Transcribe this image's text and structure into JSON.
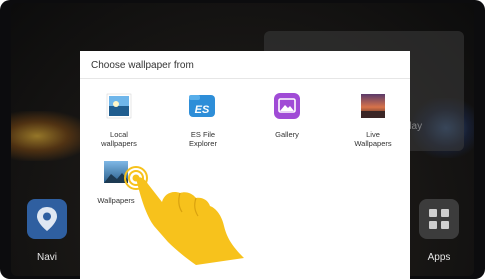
{
  "dialog": {
    "title": "Choose wallpaper from",
    "options": [
      {
        "label": "Local\nwallpapers",
        "icon": "local-wallpapers-icon"
      },
      {
        "label": "ES File\nExplorer",
        "icon": "es-file-explorer-icon"
      },
      {
        "label": "Gallery",
        "icon": "gallery-icon"
      },
      {
        "label": "Live\nWallpapers",
        "icon": "live-wallpapers-icon"
      },
      {
        "label": "Wallpapers",
        "icon": "wallpapers-icon"
      }
    ]
  },
  "dock": {
    "navi_label": "Navi",
    "apps_label": "Apps"
  },
  "background_widget_text": "day",
  "colors": {
    "accent_yellow": "#F7C21C",
    "navi_blue": "#2F5FA0",
    "gallery_purple": "#A04BD6",
    "es_blue": "#2E8ED8"
  }
}
